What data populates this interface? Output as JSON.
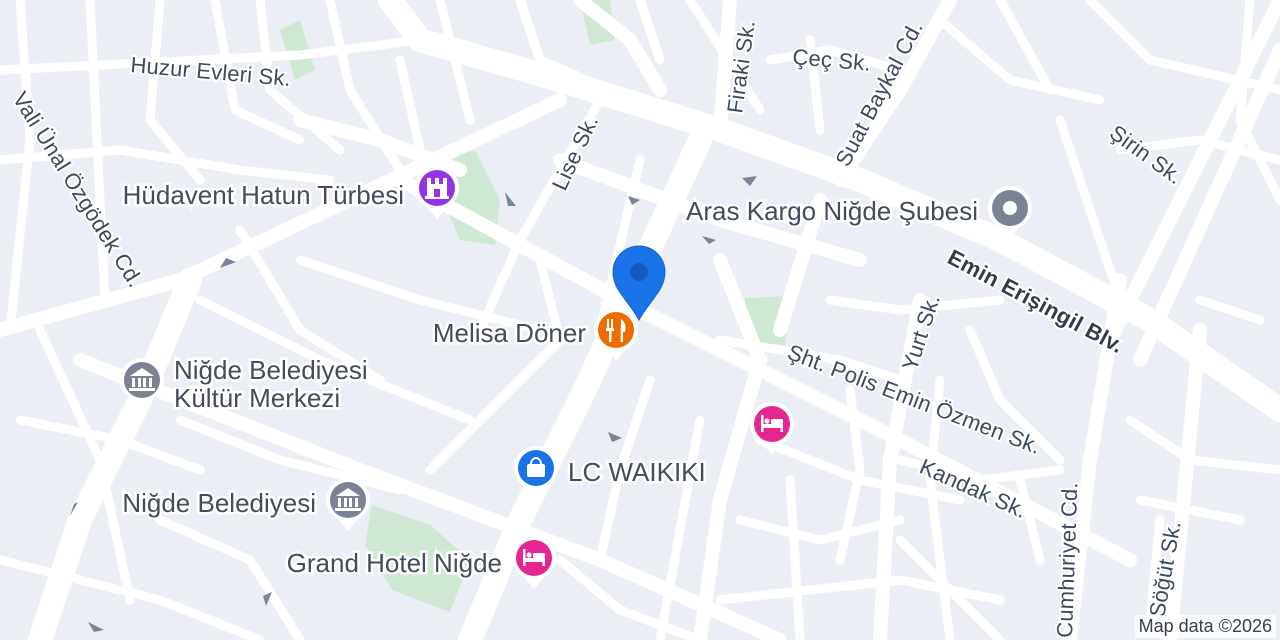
{
  "map": {
    "attribution": "Map data ©2026",
    "streets": {
      "huzur_evleri": "Huzur Evleri Sk.",
      "vali_unal": "Vali Ünal Özgödek Cd.",
      "lise": "Lise Sk.",
      "firaki": "Firaki Sk.",
      "cec": "Çeç Sk.",
      "suat_baykal": "Suat Baykal Cd.",
      "sirin": "Şirin Sk.",
      "emin_erisingil": "Emin Erişingil Blv.",
      "yurt": "Yurt Sk.",
      "sht_polis": "Şht. Polis Emin Özmen Sk.",
      "kandak": "Kandak Sk.",
      "cumhuriyet": "Cumhuriyet Cd.",
      "sogut": "Söğüt Sk."
    },
    "pois": {
      "hudavent": {
        "label": "Hüdavent Hatun Türbesi",
        "icon": "monument-icon",
        "color": "#9334e6"
      },
      "aras_kargo": {
        "label": "Aras Kargo Niğde Şubesi",
        "icon": "place-icon",
        "color": "#7b8294"
      },
      "melisa_doner": {
        "label": "Melisa Döner",
        "icon": "restaurant-icon",
        "color": "#ef6c00"
      },
      "kultur_merkezi": {
        "label_line1": "Niğde Belediyesi",
        "label_line2": "Kültür Merkezi",
        "icon": "civic-building-icon",
        "color": "#7b8294"
      },
      "hotel_unnamed": {
        "icon": "hotel-icon",
        "color": "#e52592"
      },
      "lc_waikiki": {
        "label": "LC WAIKIKI",
        "icon": "shopping-icon",
        "color": "#1a73e8"
      },
      "belediyesi": {
        "label": "Niğde Belediyesi",
        "icon": "civic-building-icon",
        "color": "#7b8294"
      },
      "grand_hotel": {
        "label": "Grand Hotel Niğde",
        "icon": "hotel-icon",
        "color": "#e52592"
      }
    },
    "selected_pin": {
      "icon": "location-pin-icon",
      "color": "#1a73e8"
    }
  }
}
